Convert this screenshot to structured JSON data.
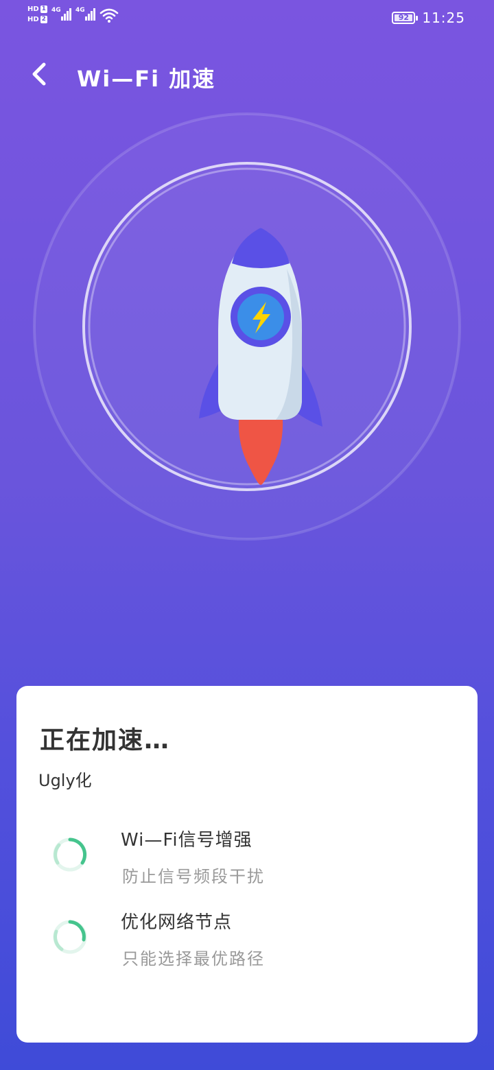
{
  "status_bar": {
    "hd1": "HD",
    "hd1_index": "1",
    "hd2": "HD",
    "hd2_index": "2",
    "net1": "4G",
    "net2": "4G",
    "battery": "92",
    "time": "11:25"
  },
  "header": {
    "back_icon": "chevron-left-icon",
    "title": "Wi—Fi 加速"
  },
  "hero": {
    "icon": "rocket-icon",
    "badge_icon": "lightning-icon"
  },
  "card": {
    "title": "正在加速…",
    "subtitle": "Ugly化",
    "tasks": [
      {
        "title": "Wi—Fi信号增强",
        "desc": "防止信号频段干扰",
        "icon": "loading-spinner-icon"
      },
      {
        "title": "优化网络节点",
        "desc": "只能选择最优路径",
        "icon": "loading-spinner-icon"
      }
    ]
  },
  "colors": {
    "bg_top": "#7a55e0",
    "bg_bottom": "#3f4bd8",
    "rocket_nose": "#5a50e6",
    "rocket_body": "#e2edf6",
    "flame": "#ef5545",
    "bolt": "#ffd400",
    "spinner": "#45c48d"
  }
}
